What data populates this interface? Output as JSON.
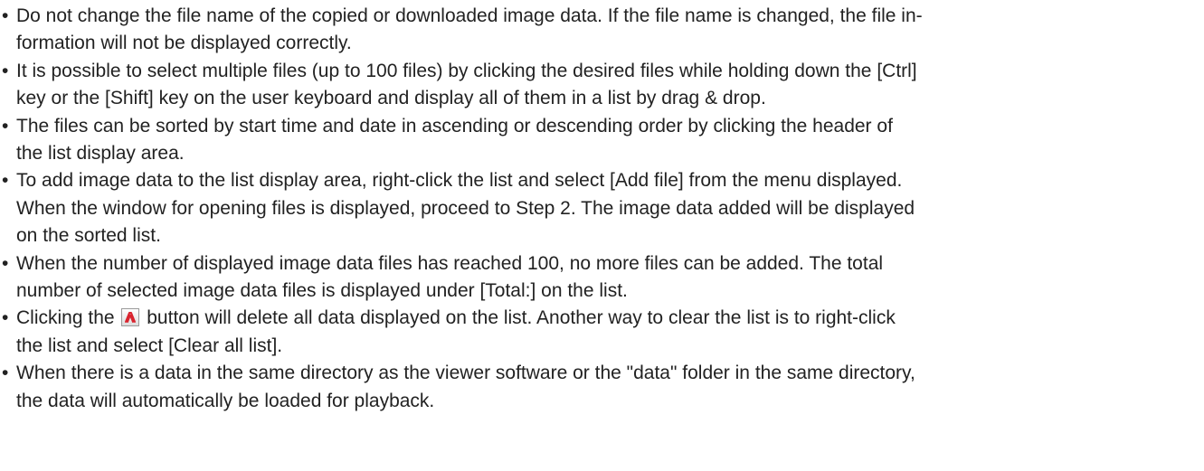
{
  "notes": [
    {
      "lines": [
        "Do not change the file name of the copied or downloaded image data. If the file name is changed, the file in-",
        "formation will not be displayed correctly."
      ]
    },
    {
      "lines": [
        "It is possible to select multiple files (up to 100 files) by clicking the desired files while holding down the [Ctrl]",
        "key or the [Shift] key on the user keyboard and display all of them in a list by drag & drop."
      ]
    },
    {
      "lines": [
        "The files can be sorted by start time and date in ascending or descending order by clicking the header of",
        "the list display area."
      ]
    },
    {
      "lines": [
        "To add image data to the list display area, right-click the list and select [Add file] from the menu displayed.",
        "When the window for opening files is displayed, proceed to Step 2. The image data added will be displayed",
        "on the sorted list."
      ]
    },
    {
      "lines": [
        "When the number of displayed image data files has reached 100, no more files can be added. The total",
        "number of selected image data files is displayed under [Total:] on the list."
      ]
    },
    {
      "line1_before": "Clicking the",
      "line1_after": "button will delete all data displayed on the list. Another way to clear the list is to right-click",
      "line2": "the list and select [Clear all list].",
      "icon": "clear-list-icon",
      "icon_color": "#d9232e"
    },
    {
      "lines": [
        "When there is a data in the same directory as the viewer software or the \"data\" folder in the same directory,",
        "the data will automatically be loaded for playback."
      ]
    }
  ]
}
